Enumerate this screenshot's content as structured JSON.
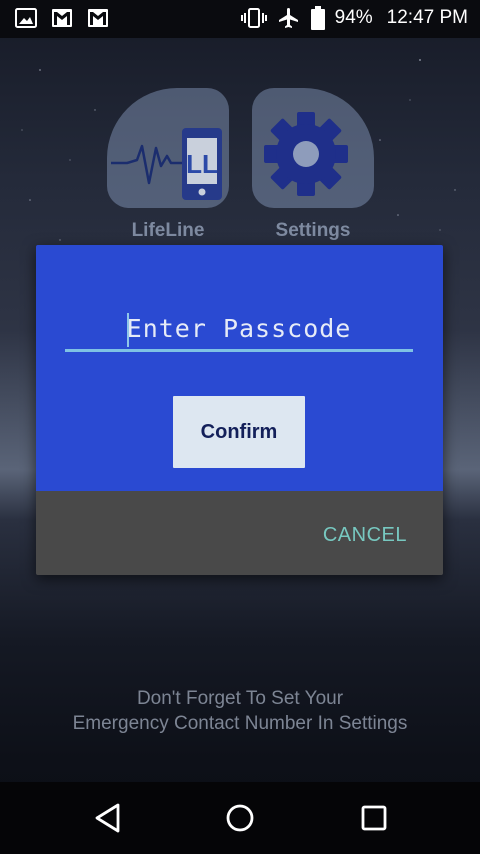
{
  "status_bar": {
    "left_icons": [
      "gallery-icon",
      "gmail-icon",
      "gmail-icon"
    ],
    "right_icons": [
      "vibrate-icon",
      "airplane-mode-icon",
      "battery-icon"
    ],
    "battery": "94%",
    "time": "12:47 PM"
  },
  "apps": [
    {
      "label": "LifeLine",
      "icon": "lifeline-phone-heartbeat-icon",
      "badge": "LL"
    },
    {
      "label": "Settings",
      "icon": "gear-icon"
    }
  ],
  "dialog": {
    "input_placeholder": "Enter Passcode",
    "input_value": "",
    "confirm_label": "Confirm",
    "cancel_label": "CANCEL"
  },
  "reminder": {
    "line1": "Don't Forget To Set Your",
    "line2": "Emergency Contact Number In Settings"
  },
  "nav_bar": {
    "icons": [
      "back-icon",
      "home-icon",
      "recents-icon"
    ]
  },
  "colors": {
    "dialog_top": "#2a4ad2",
    "dialog_bottom": "#494949",
    "confirm_bg": "#dde7f1",
    "confirm_text": "#13205a",
    "cancel_text": "#77c8c0",
    "input_underline": "#7fc2e4"
  }
}
